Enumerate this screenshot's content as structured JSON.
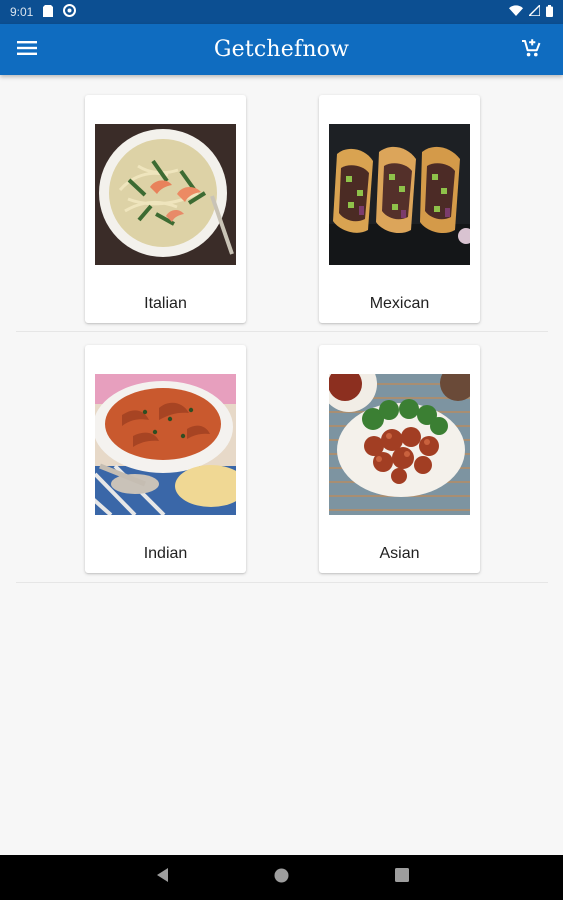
{
  "status_bar": {
    "time": "9:01",
    "icons": [
      "sd-card-icon",
      "sync-icon",
      "wifi-icon",
      "signal-icon",
      "battery-icon"
    ]
  },
  "app_bar": {
    "title": "Getchefnow",
    "menu_icon": "hamburger-menu-icon",
    "cart_icon": "add-to-cart-icon",
    "color": "#0f6cc0"
  },
  "categories": [
    {
      "label": "Italian",
      "image": "pasta-shrimp-dish"
    },
    {
      "label": "Mexican",
      "image": "tacos-dish"
    },
    {
      "label": "Indian",
      "image": "butter-chicken-dish"
    },
    {
      "label": "Asian",
      "image": "glazed-chicken-broccoli-dish"
    }
  ],
  "nav_bar": {
    "icons": [
      "back-icon",
      "home-icon",
      "recents-icon"
    ]
  }
}
